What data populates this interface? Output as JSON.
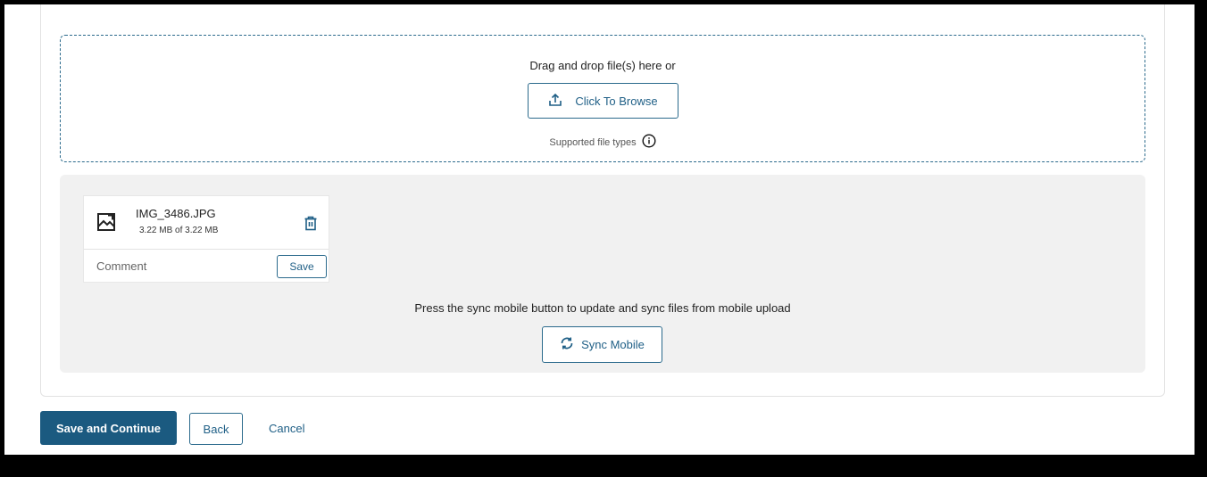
{
  "dropzone": {
    "prompt": "Drag and drop file(s) here or",
    "browse_label": "Click To Browse",
    "supported_label": "Supported file types"
  },
  "files": [
    {
      "name": "IMG_3486.JPG",
      "size_text": "3.22 MB of 3.22 MB",
      "comment_placeholder": "Comment",
      "save_label": "Save"
    }
  ],
  "sync": {
    "message": "Press the sync mobile button to update and sync files from mobile upload",
    "button_label": "Sync Mobile"
  },
  "footer": {
    "save_continue_label": "Save and Continue",
    "back_label": "Back",
    "cancel_label": "Cancel"
  },
  "colors": {
    "accent": "#1f5f86",
    "primary_button": "#1b5a80",
    "panel_bg": "#f1f1f1"
  },
  "icons": {
    "upload": "upload-icon",
    "info": "info-icon",
    "image": "image-file-icon",
    "trash": "trash-icon",
    "sync": "sync-icon"
  }
}
